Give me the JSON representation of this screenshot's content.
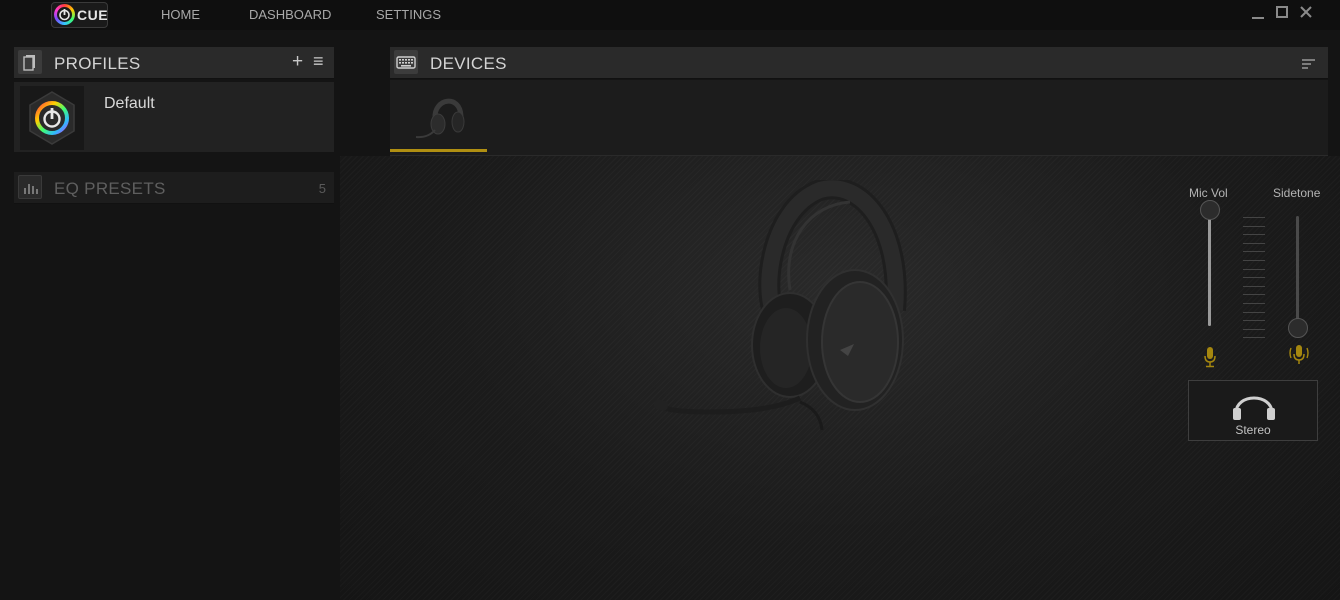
{
  "app": {
    "logo_text": "CUE"
  },
  "nav": {
    "home": "HOME",
    "dashboard": "DASHBOARD",
    "settings": "SETTINGS"
  },
  "window_controls": {
    "minimize": "_",
    "maximize": "☐",
    "close": "✕"
  },
  "profiles": {
    "title": "PROFILES",
    "add_symbol": "+",
    "menu_symbol": "≡",
    "items": [
      {
        "name": "Default"
      }
    ]
  },
  "eq_presets": {
    "title": "EQ PRESETS",
    "count": "5"
  },
  "devices": {
    "title": "DEVICES",
    "selected_device": "headset"
  },
  "controls": {
    "mic_vol": {
      "label": "Mic Vol",
      "level": 1.0
    },
    "sidetone": {
      "label": "Sidetone",
      "level": 0.0
    },
    "audio_mode": {
      "label": "Stereo"
    }
  },
  "colors": {
    "accent": "#b08f12",
    "background": "#141414",
    "panel": "#2a2a2a"
  }
}
